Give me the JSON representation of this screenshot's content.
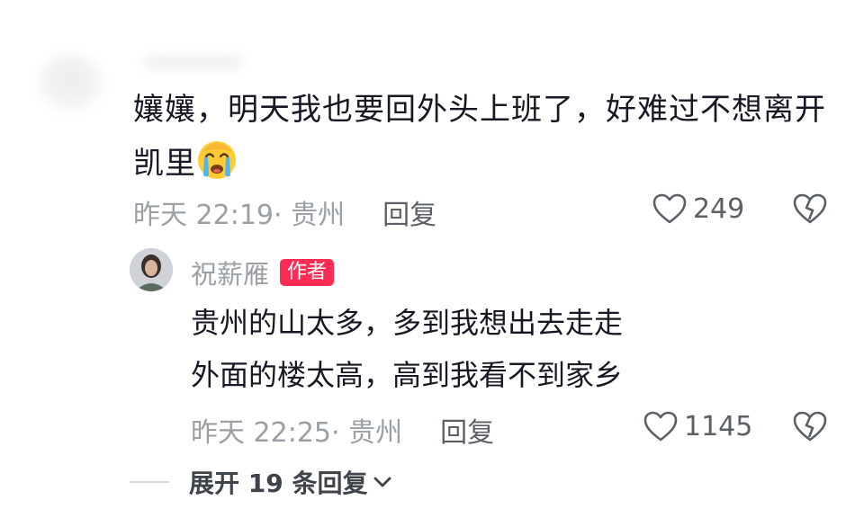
{
  "comment": {
    "line1": "孃孃，明天我也要回外头上班了，好难过不想离开",
    "line2": "凯里",
    "emoji": "crying-face",
    "time": "昨天 22:19",
    "location": "· 贵州",
    "reply_label": "回复",
    "likes": "249"
  },
  "reply": {
    "author": "祝薪雁",
    "author_tag": "作者",
    "line1": "贵州的山太多，多到我想出去走走",
    "line2": "外面的楼太高，高到我看不到家乡",
    "time": "昨天 22:25",
    "location": "· 贵州",
    "reply_label": "回复",
    "likes": "1145"
  },
  "expand_label": "展开 19 条回复",
  "colors": {
    "accent": "#fe2c55",
    "muted": "#9aa0a6",
    "text": "#161823"
  }
}
